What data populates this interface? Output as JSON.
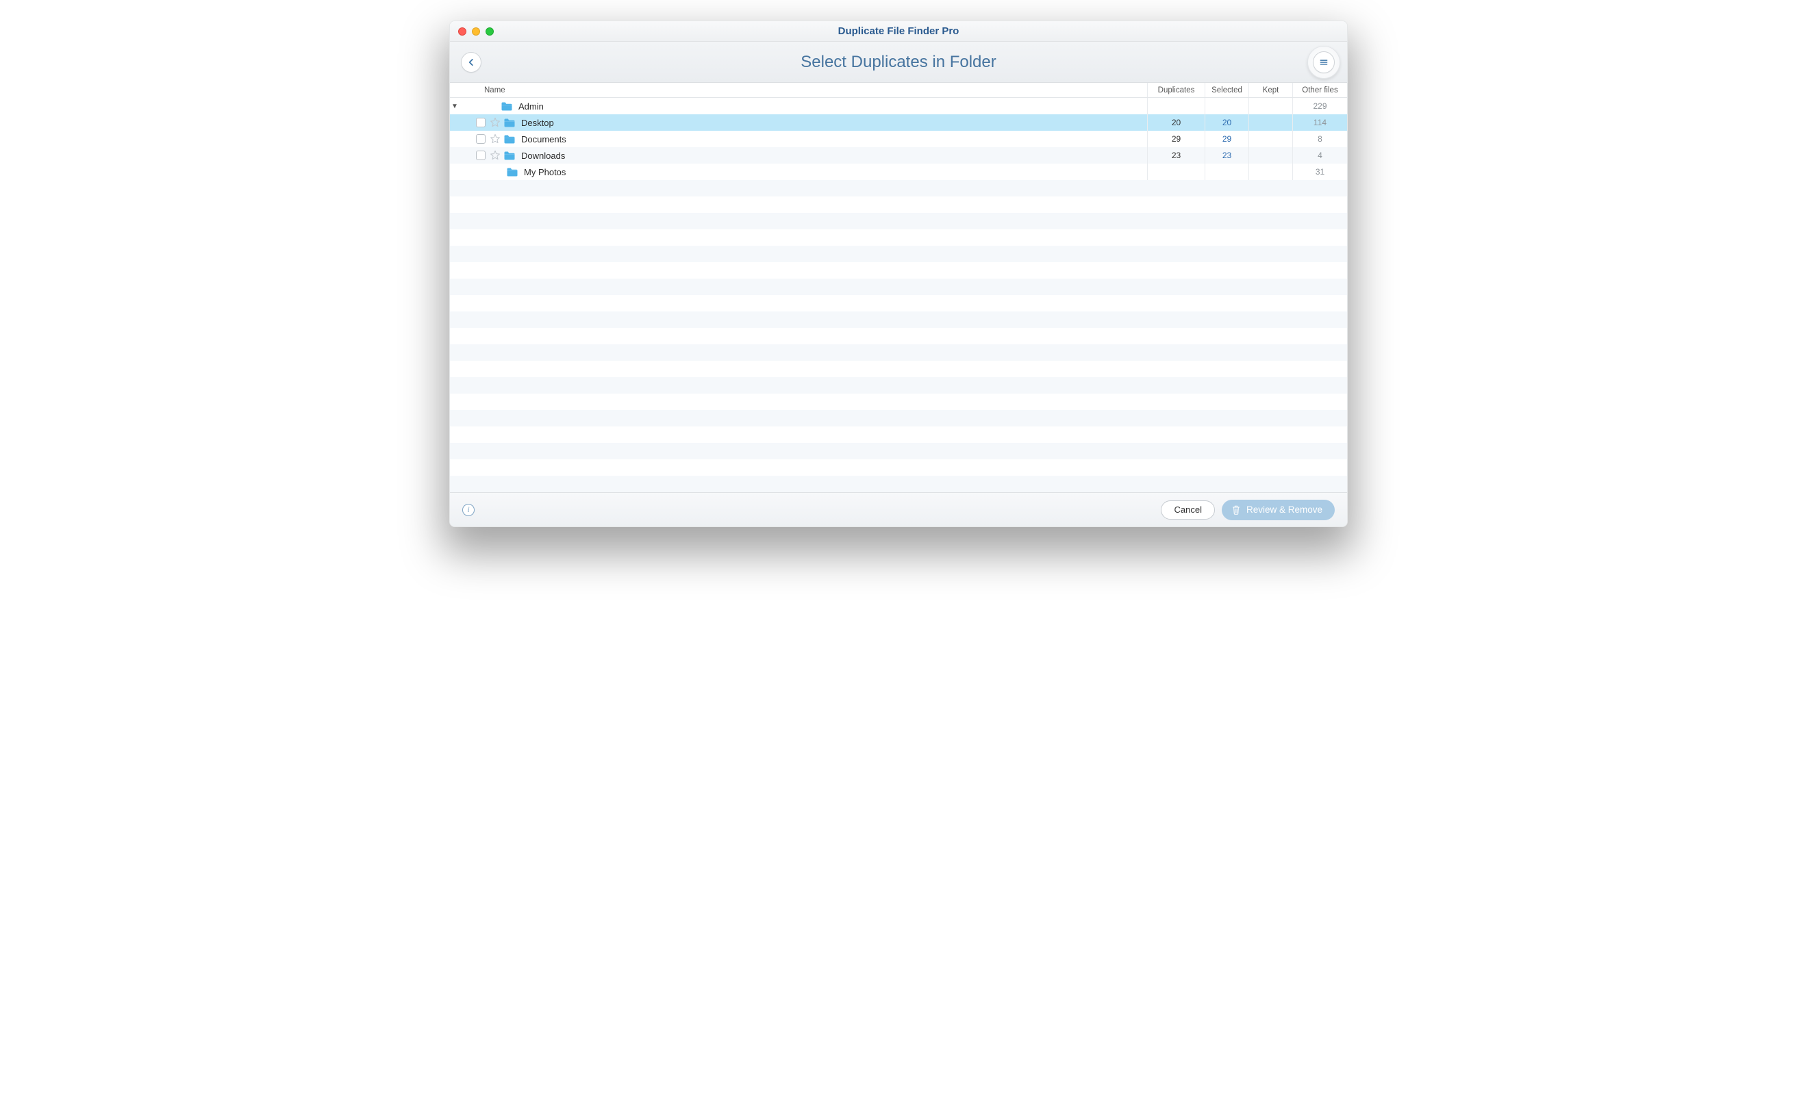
{
  "window": {
    "title": "Duplicate File Finder Pro"
  },
  "toolbar": {
    "back_icon": "chevron-left",
    "title": "Select Duplicates in Folder",
    "menu_icon": "hamburger"
  },
  "columns": {
    "name": "Name",
    "duplicates": "Duplicates",
    "selected": "Selected",
    "kept": "Kept",
    "other": "Other files"
  },
  "tree": [
    {
      "depth": 0,
      "expanded": true,
      "has_checkbox": false,
      "has_star": false,
      "name": "Admin",
      "duplicates": "",
      "selected": "",
      "kept": "",
      "other": "229",
      "highlight": "none"
    },
    {
      "depth": 1,
      "expanded": null,
      "has_checkbox": true,
      "has_star": true,
      "name": "Desktop",
      "duplicates": "20",
      "selected": "20",
      "kept": "",
      "other": "114",
      "highlight": "selected"
    },
    {
      "depth": 1,
      "expanded": null,
      "has_checkbox": true,
      "has_star": true,
      "name": "Documents",
      "duplicates": "29",
      "selected": "29",
      "kept": "",
      "other": "8",
      "highlight": "none"
    },
    {
      "depth": 1,
      "expanded": null,
      "has_checkbox": true,
      "has_star": true,
      "name": "Downloads",
      "duplicates": "23",
      "selected": "23",
      "kept": "",
      "other": "4",
      "highlight": "even"
    },
    {
      "depth": 1,
      "expanded": null,
      "has_checkbox": false,
      "has_star": false,
      "name": "My Photos",
      "duplicates": "",
      "selected": "",
      "kept": "",
      "other": "31",
      "highlight": "none"
    }
  ],
  "empty_rows": 19,
  "footer": {
    "info_icon": "info",
    "cancel": "Cancel",
    "review": "Review & Remove",
    "trash_icon": "trash"
  }
}
